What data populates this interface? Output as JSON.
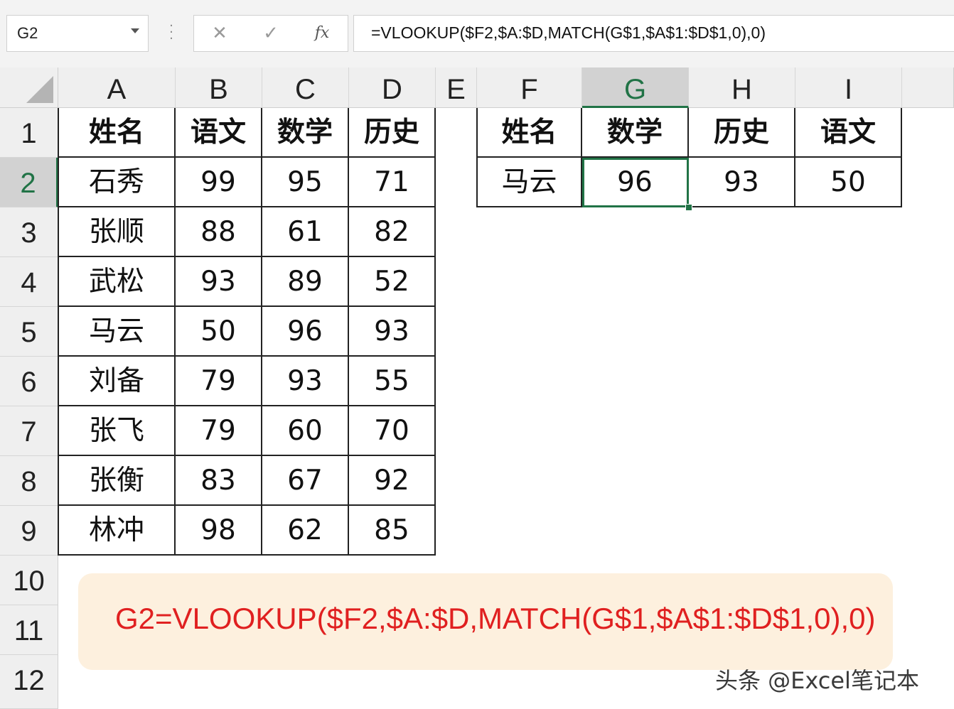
{
  "formula_bar": {
    "name_box": "G2",
    "cancel_icon": "✕",
    "enter_icon": "✓",
    "fx_label": "fx",
    "formula": "=VLOOKUP($F2,$A:$D,MATCH(G$1,$A$1:$D$1,0),0)"
  },
  "columns": [
    "A",
    "B",
    "C",
    "D",
    "E",
    "F",
    "G",
    "H",
    "I"
  ],
  "rows": [
    "1",
    "2",
    "3",
    "4",
    "5",
    "6",
    "7",
    "8",
    "9",
    "10",
    "11",
    "12"
  ],
  "selected": {
    "column": "G",
    "row": "2"
  },
  "left_table": {
    "headers": [
      "姓名",
      "语文",
      "数学",
      "历史"
    ],
    "rows": [
      [
        "石秀",
        "99",
        "95",
        "71"
      ],
      [
        "张顺",
        "88",
        "61",
        "82"
      ],
      [
        "武松",
        "93",
        "89",
        "52"
      ],
      [
        "马云",
        "50",
        "96",
        "93"
      ],
      [
        "刘备",
        "79",
        "93",
        "55"
      ],
      [
        "张飞",
        "79",
        "60",
        "70"
      ],
      [
        "张衡",
        "83",
        "67",
        "92"
      ],
      [
        "林冲",
        "98",
        "62",
        "85"
      ]
    ]
  },
  "right_table": {
    "headers": [
      "姓名",
      "数学",
      "历史",
      "语文"
    ],
    "row": [
      "马云",
      "96",
      "93",
      "50"
    ]
  },
  "callout": {
    "text": "G2=VLOOKUP($F2,$A:$D,MATCH(G$1,$A$1:$D$1,0),0)"
  },
  "watermark": "头条 @Excel笔记本",
  "colors": {
    "accent": "#217346",
    "callout_text": "#e02020",
    "callout_bg": "#fdf0de"
  }
}
